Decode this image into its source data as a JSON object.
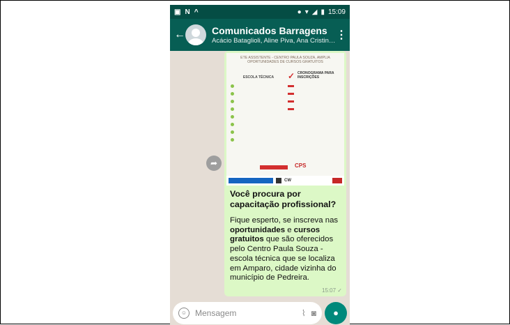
{
  "status_bar": {
    "time": "15:09",
    "left_icons": [
      "image-icon",
      "n-icon",
      "cat-icon"
    ],
    "right_icons": [
      "alarm-icon",
      "wifi-icon",
      "signal-icon",
      "battery-icon"
    ]
  },
  "header": {
    "title": "Comunicados Barragens",
    "subtitle": "Acácio Bataglioli, Aline Piva, Ana Cristina ,.",
    "colors": {
      "bar": "#075e54",
      "status": "#054d44"
    }
  },
  "message": {
    "image": {
      "header": "ETE ASSISTENTE - CENTRO PAULA SOUZA, AMPLIA OPORTUNIDADES DE CURSOS GRATUITOS",
      "subheader": "",
      "left_title": "ESCOLA TÉCNICA",
      "left_caption": "",
      "courses": [
        "",
        "",
        "",
        "",
        "",
        "",
        "",
        ""
      ],
      "right_title": "CRONOGRAMA PARA INSCRIÇÕES",
      "right_items": [
        "",
        "",
        "",
        ""
      ],
      "footer_text": "",
      "cps_logo": "CPS",
      "logos_strip_label": "",
      "logos_text": "CW"
    },
    "headline": "Você procura por capacitação profissional?",
    "body": {
      "p1": "Fique esperto, se inscreva nas ",
      "b1": "oportunidades",
      "p2": " e ",
      "b2": "cursos gratuitos",
      "p3": " que são oferecidos pelo Centro Paula Souza - escola técnica que se localiza em Amparo, cidade vizinha do município de Pedreira."
    },
    "time": "15:07 ✓",
    "bubble_color": "#dcf8c6"
  },
  "input": {
    "placeholder": "Mensagem",
    "icons": [
      "emoji-icon",
      "attach-icon",
      "camera-icon",
      "mic-icon"
    ]
  },
  "accent": "#00897b"
}
